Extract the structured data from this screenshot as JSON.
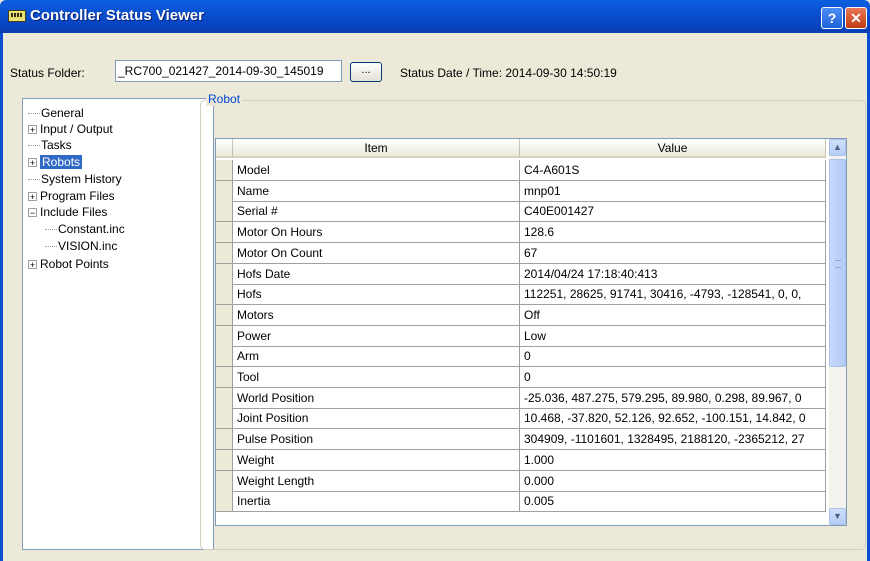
{
  "window": {
    "title": "Controller Status Viewer",
    "help_label": "?",
    "close_label": "✕"
  },
  "toolbar": {
    "status_folder_label": "Status Folder:",
    "status_folder_value": "_RC700_021427_2014-09-30_145019",
    "browse_label": "...",
    "status_date_label": "Status Date / Time: 2014-09-30 14:50:19"
  },
  "tree": {
    "items": [
      {
        "label": "General",
        "expandable": false
      },
      {
        "label": "Input / Output",
        "expandable": true
      },
      {
        "label": "Tasks",
        "expandable": false
      },
      {
        "label": "Robots",
        "expandable": true,
        "selected": true
      },
      {
        "label": "System History",
        "expandable": false
      },
      {
        "label": "Program Files",
        "expandable": true
      },
      {
        "label": "Include Files",
        "expandable": true,
        "expanded": true
      },
      {
        "label": "Constant.inc",
        "expandable": false,
        "child": true
      },
      {
        "label": "VISION.inc",
        "expandable": false,
        "child": true
      },
      {
        "label": "Robot Points",
        "expandable": true
      }
    ]
  },
  "group": {
    "label": "Robot"
  },
  "grid": {
    "headers": {
      "item": "Item",
      "value": "Value"
    },
    "rows": [
      {
        "item": "Model",
        "value": "C4-A601S"
      },
      {
        "item": "Name",
        "value": "mnp01"
      },
      {
        "item": "Serial #",
        "value": "C40E001427"
      },
      {
        "item": "Motor On Hours",
        "value": "128.6"
      },
      {
        "item": "Motor On Count",
        "value": "67"
      },
      {
        "item": "Hofs Date",
        "value": "2014/04/24 17:18:40:413"
      },
      {
        "item": "Hofs",
        "value": "112251, 28625, 91741, 30416, -4793, -128541, 0, 0,"
      },
      {
        "item": "Motors",
        "value": "Off"
      },
      {
        "item": "Power",
        "value": "Low"
      },
      {
        "item": "Arm",
        "value": "0"
      },
      {
        "item": "Tool",
        "value": "0"
      },
      {
        "item": "World Position",
        "value": "-25.036, 487.275, 579.295, 89.980, 0.298, 89.967, 0"
      },
      {
        "item": "Joint Position",
        "value": "10.468, -37.820, 52.126, 92.652, -100.151, 14.842, 0"
      },
      {
        "item": "Pulse Position",
        "value": "304909, -1101601, 1328495, 2188120, -2365212, 27"
      },
      {
        "item": "Weight",
        "value": "1.000"
      },
      {
        "item": "Weight Length",
        "value": "0.000"
      },
      {
        "item": "Inertia",
        "value": "0.005"
      }
    ]
  },
  "scrollbar": {
    "up": "▲",
    "down": "▼"
  }
}
